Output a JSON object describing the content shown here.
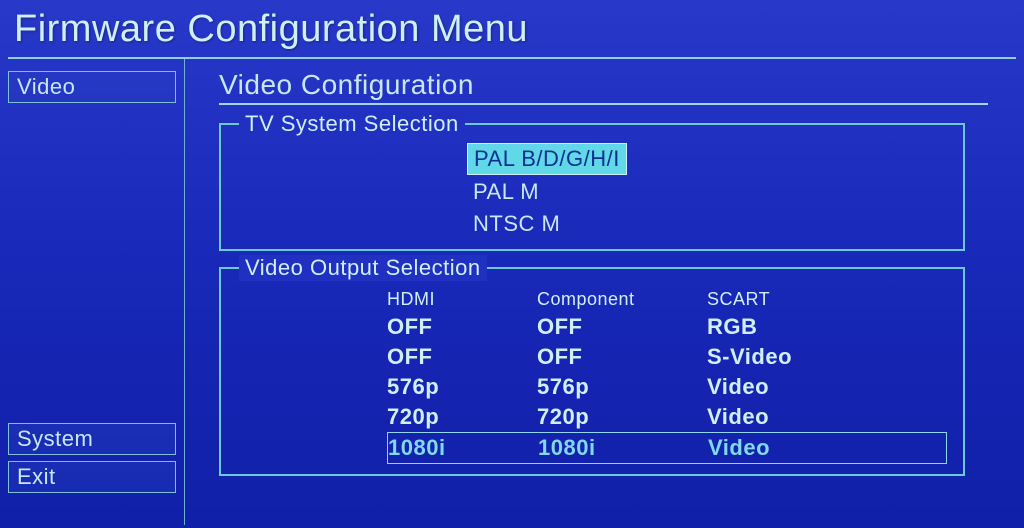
{
  "title": "Firmware Configuration Menu",
  "sidebar": {
    "top": [
      {
        "label": "Video"
      }
    ],
    "bottom": [
      {
        "label": "System"
      },
      {
        "label": "Exit"
      }
    ]
  },
  "main": {
    "heading": "Video Configuration",
    "tv_system": {
      "group_label": "TV System Selection",
      "options": [
        "PAL B/D/G/H/I",
        "PAL M",
        "NTSC M"
      ],
      "selected_index": 0
    },
    "video_output": {
      "group_label": "Video Output Selection",
      "headers": [
        "HDMI",
        "Component",
        "SCART"
      ],
      "rows": [
        {
          "cells": [
            "OFF",
            "OFF",
            "RGB"
          ]
        },
        {
          "cells": [
            "OFF",
            "OFF",
            "S-Video"
          ]
        },
        {
          "cells": [
            "576p",
            "576p",
            "Video"
          ]
        },
        {
          "cells": [
            "720p",
            "720p",
            "Video"
          ]
        },
        {
          "cells": [
            "1080i",
            "1080i",
            "Video"
          ]
        }
      ],
      "selected_index": 4
    }
  }
}
